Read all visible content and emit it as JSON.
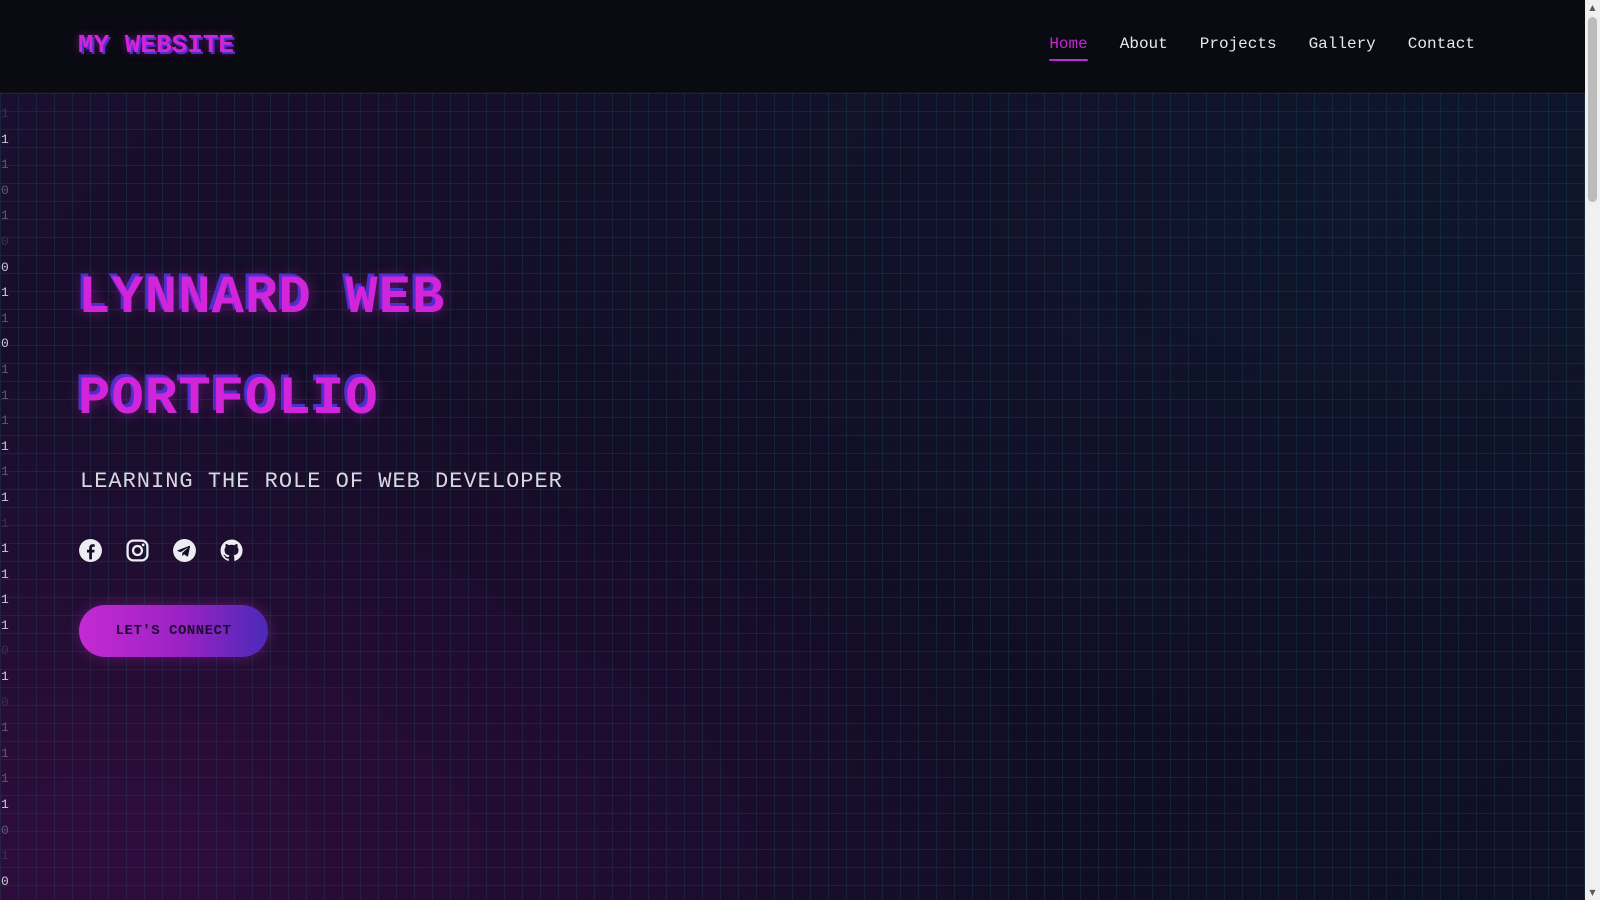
{
  "header": {
    "logo": "MY WEBSITE",
    "nav": [
      {
        "label": "Home",
        "active": true
      },
      {
        "label": "About",
        "active": false
      },
      {
        "label": "Projects",
        "active": false
      },
      {
        "label": "Gallery",
        "active": false
      },
      {
        "label": "Contact",
        "active": false
      }
    ]
  },
  "hero": {
    "title_line1": "LYNNARD WEB",
    "title_line2": "PORTFOLIO",
    "tagline": "LEARNING THE ROLE OF WEB DEVELOPER",
    "socials": [
      {
        "name": "facebook-icon"
      },
      {
        "name": "instagram-icon"
      },
      {
        "name": "telegram-icon"
      },
      {
        "name": "github-icon"
      }
    ],
    "cta_label": "LET'S CONNECT",
    "binary_rain": [
      "1",
      "1",
      "1",
      "0",
      "1",
      "0",
      "0",
      "1",
      "1",
      "0",
      "1",
      "1",
      "1",
      "1",
      "1",
      "1",
      "1",
      "1",
      "1",
      "1",
      "1",
      "0",
      "1",
      "0",
      "1",
      "1",
      "1",
      "1",
      "0",
      "1",
      "0"
    ]
  },
  "colors": {
    "accent": "#d224d8",
    "accent_shadow": "#4b2fd0",
    "header_bg": "#0a0a12",
    "hero_bg": "#140d28",
    "text": "#e8e8ee"
  }
}
